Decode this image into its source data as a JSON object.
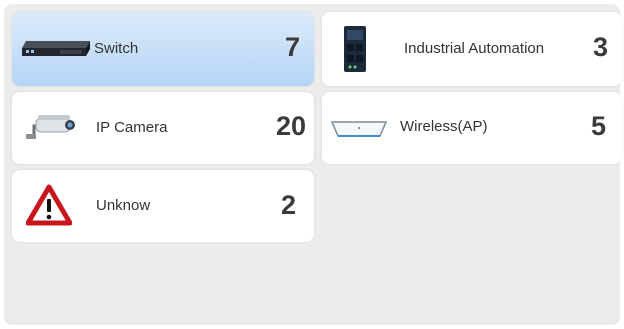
{
  "device_tiles": [
    {
      "key": "switch",
      "label": "Switch",
      "count": "7",
      "icon": "switch-icon",
      "selected": true
    },
    {
      "key": "industrial",
      "label": "Industrial Automation",
      "count": "3",
      "icon": "industrial-device-icon",
      "selected": false
    },
    {
      "key": "camera",
      "label": "IP Camera",
      "count": "20",
      "icon": "ip-camera-icon",
      "selected": false
    },
    {
      "key": "wireless",
      "label": "Wireless(AP)",
      "count": "5",
      "icon": "access-point-icon",
      "selected": false
    },
    {
      "key": "unknown",
      "label": "Unknow",
      "count": "2",
      "icon": "warning-icon",
      "selected": false
    }
  ],
  "colors": {
    "panel_background": "#ececec",
    "tile_background": "#ffffff",
    "selected_tile_top": "#dcebfb",
    "selected_tile_bottom": "#b5d4f5",
    "warning_red": "#c8161d"
  }
}
